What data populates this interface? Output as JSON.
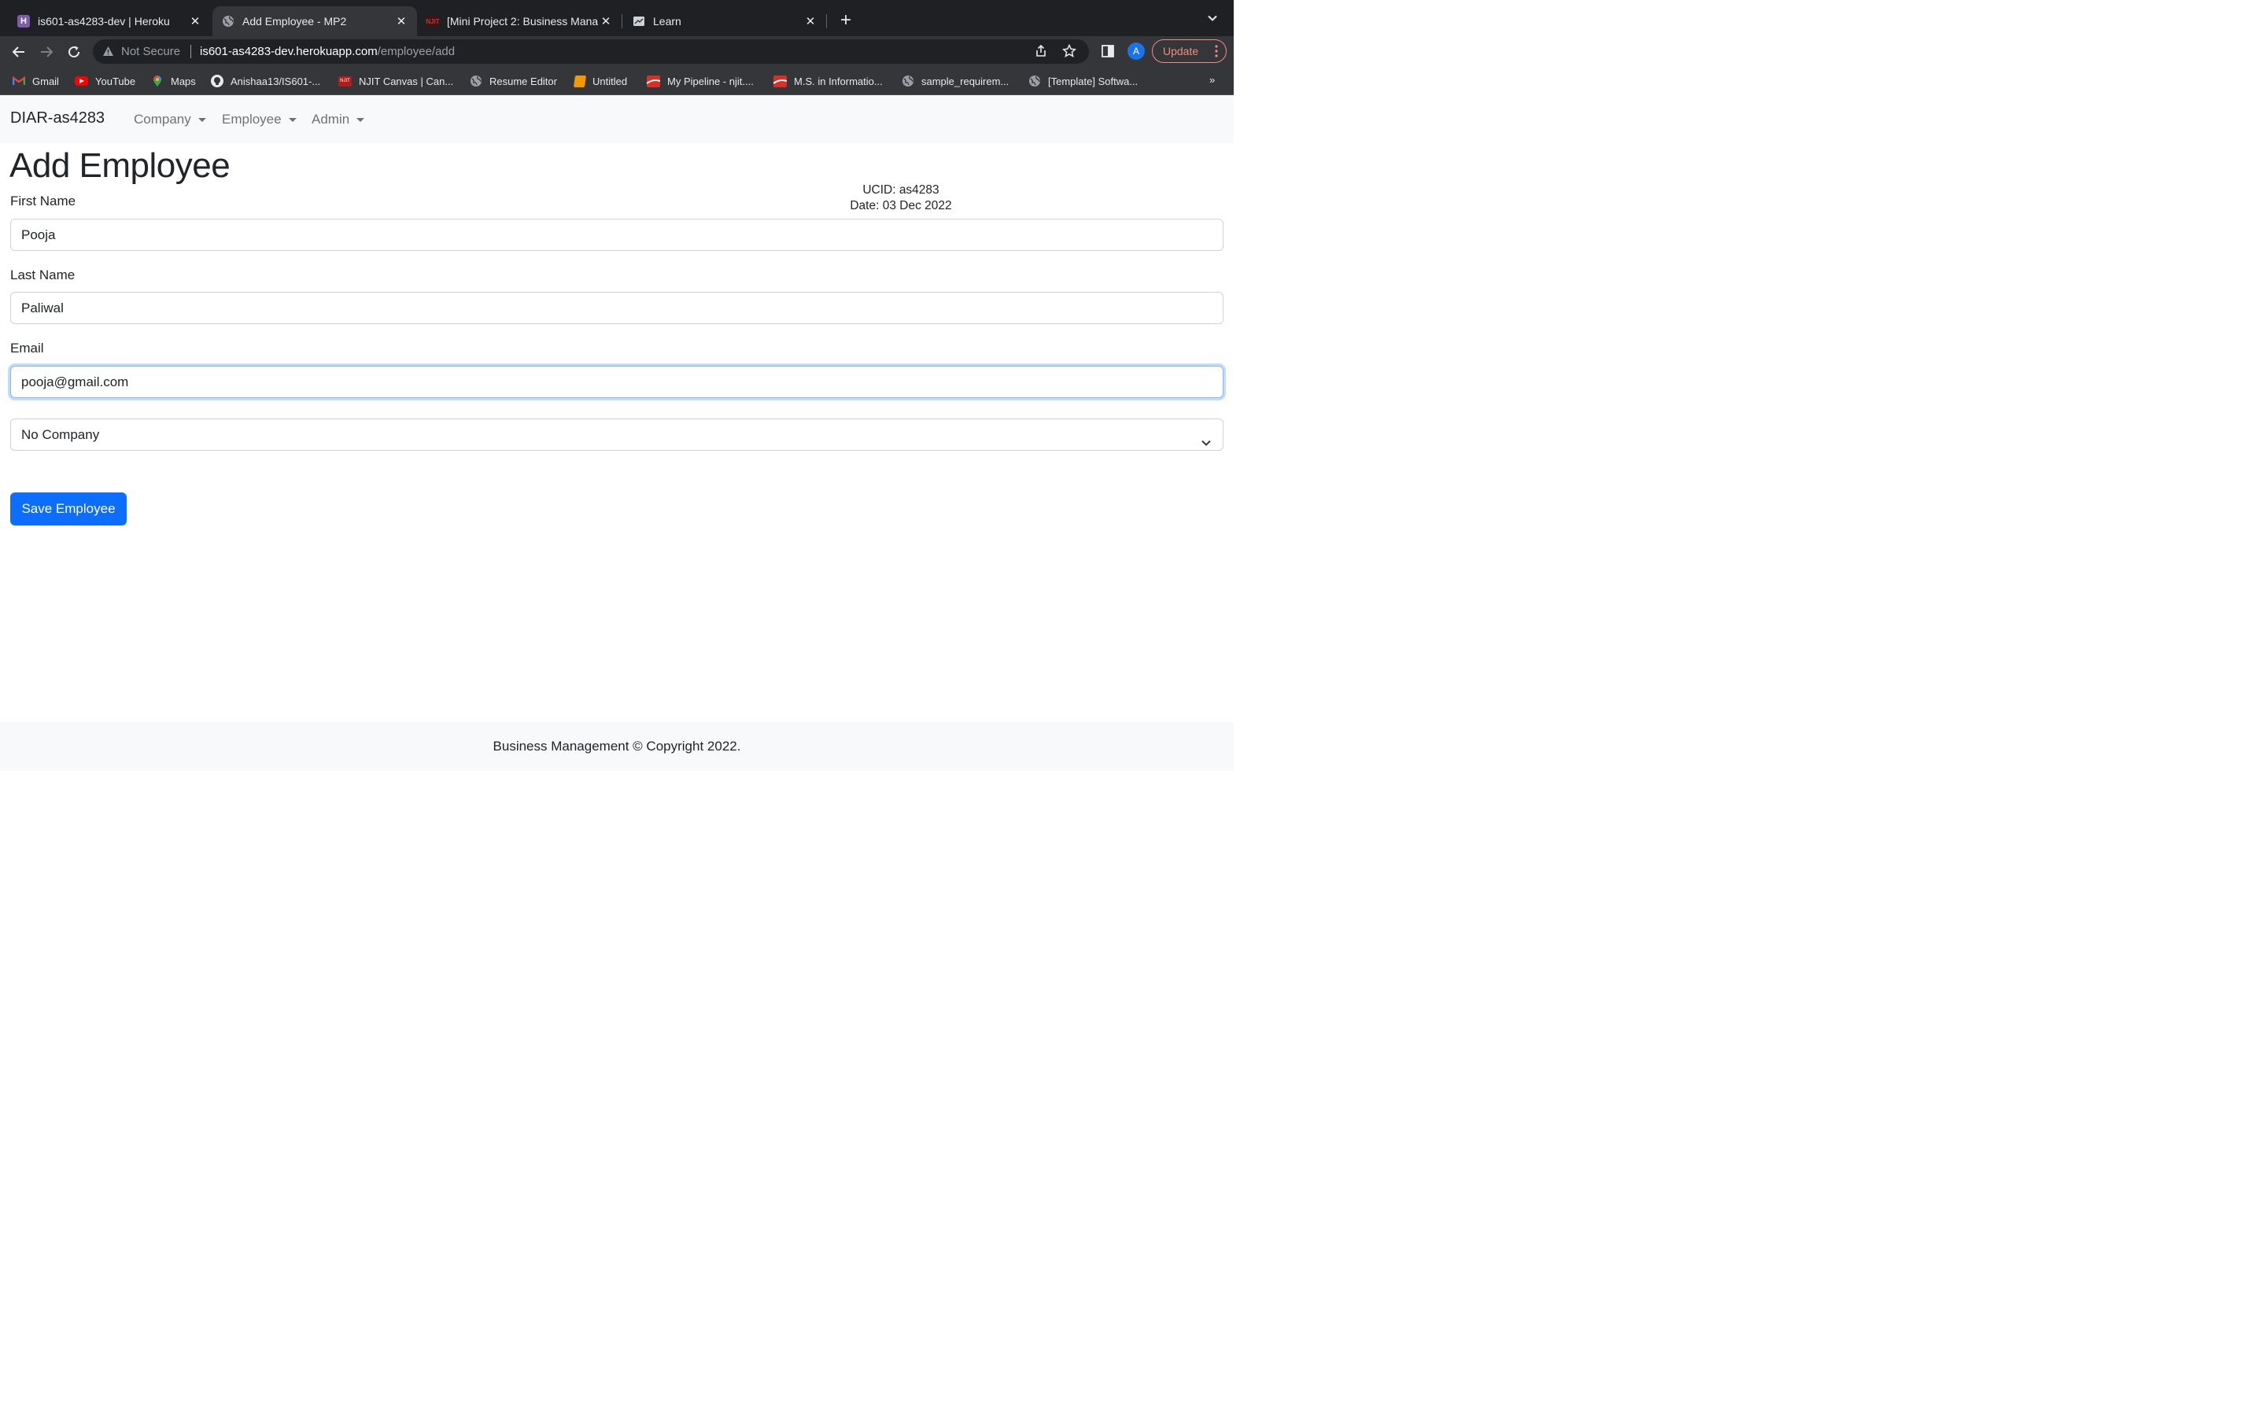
{
  "browser": {
    "tabs": [
      {
        "title": "is601-as4283-dev | Heroku",
        "icon": "heroku-icon",
        "active": false
      },
      {
        "title": "Add Employee - MP2",
        "icon": "globe-icon",
        "active": true
      },
      {
        "title": "[Mini Project 2: Business Mana",
        "icon": "njit-icon",
        "active": false
      },
      {
        "title": "Learn",
        "icon": "learn-icon",
        "active": false
      }
    ],
    "address": {
      "security_label": "Not Secure",
      "host": "is601-as4283-dev.herokuapp.com",
      "path": "/employee/add"
    },
    "profile_initial": "A",
    "update_label": "Update",
    "bookmarks": [
      {
        "label": "Gmail",
        "icon": "gmail-icon"
      },
      {
        "label": "YouTube",
        "icon": "youtube-icon"
      },
      {
        "label": "Maps",
        "icon": "maps-icon"
      },
      {
        "label": "Anishaa13/IS601-...",
        "icon": "github-icon"
      },
      {
        "label": "NJIT Canvas | Can...",
        "icon": "njit-icon"
      },
      {
        "label": "Resume Editor",
        "icon": "globe-icon"
      },
      {
        "label": "Untitled",
        "icon": "notebook-icon"
      },
      {
        "label": "My Pipeline - njit....",
        "icon": "flag-icon"
      },
      {
        "label": "M.S. in Informatio...",
        "icon": "flag-icon"
      },
      {
        "label": "sample_requirem...",
        "icon": "globe-icon"
      },
      {
        "label": "[Template] Softwa...",
        "icon": "globe-icon"
      }
    ],
    "bookmarks_more": "»"
  },
  "app": {
    "brand": "DIAR-as4283",
    "nav": [
      "Company",
      "Employee",
      "Admin"
    ],
    "page_title": "Add Employee",
    "ucid_line": "UCID: as4283",
    "date_line": "Date: 03 Dec 2022",
    "form": {
      "first_name_label": "First Name",
      "first_name_value": "Pooja",
      "last_name_label": "Last Name",
      "last_name_value": "Paliwal",
      "email_label": "Email",
      "email_value": "pooja@gmail.com",
      "company_selected": "No Company",
      "submit_label": "Save Employee"
    },
    "footer": "Business Management © Copyright 2022."
  },
  "colors": {
    "primary": "#0d6efd",
    "navbar_bg": "#f8f9fa",
    "focus_border": "#86b7fe"
  }
}
